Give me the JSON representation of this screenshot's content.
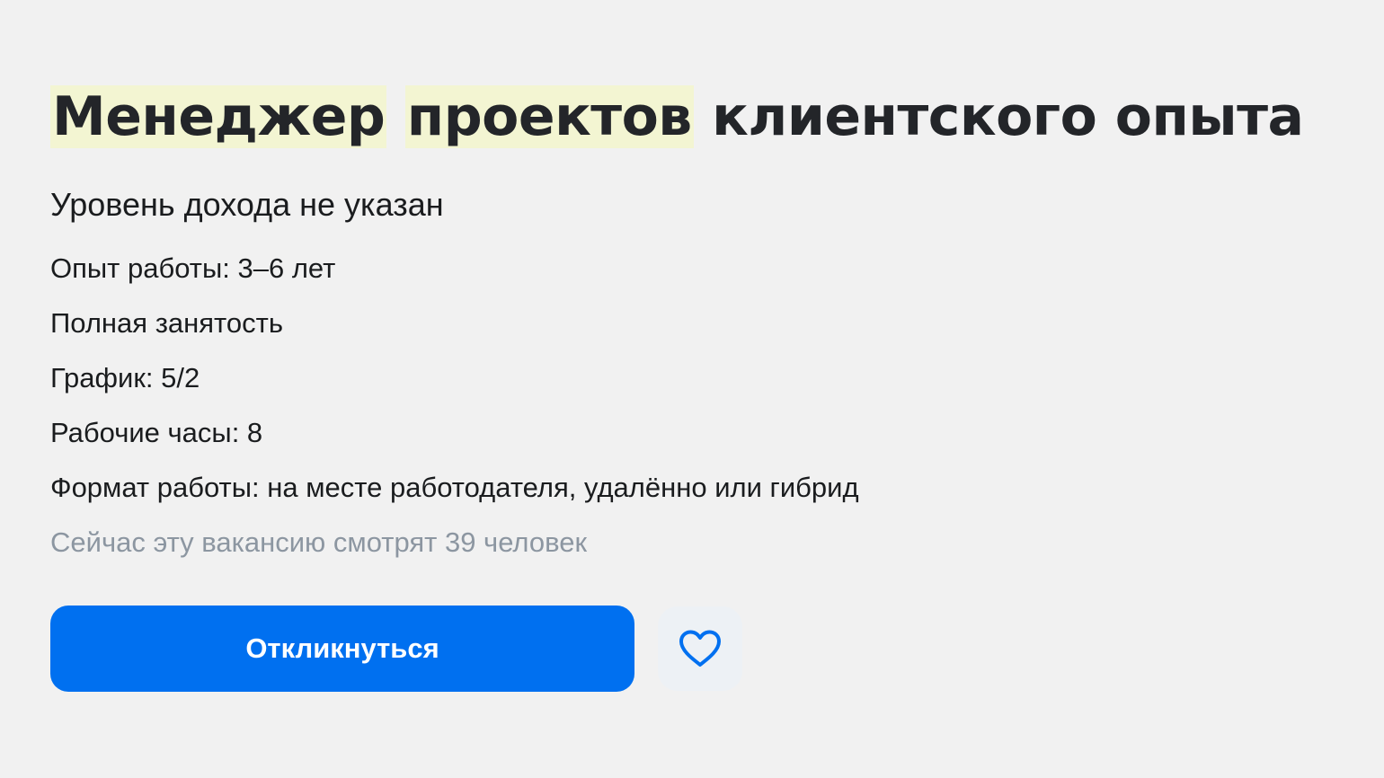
{
  "vacancy": {
    "title_highlight_1": "Менеджер",
    "title_highlight_2": "проектов",
    "title_rest": "клиентского опыта",
    "salary": "Уровень дохода не указан",
    "experience": "Опыт работы: 3–6 лет",
    "employment": "Полная занятость",
    "schedule": "График: 5/2",
    "hours": "Рабочие часы: 8",
    "work_format": "Формат работы: на месте работодателя, удалённо или гибрид",
    "viewers": "Сейчас эту вакансию смотрят 39 человек"
  },
  "actions": {
    "respond_label": "Откликнуться",
    "favorite_icon": "heart-icon"
  },
  "colors": {
    "background": "#f1f1f1",
    "highlight": "#f3f5d2",
    "primary": "#0070f0",
    "muted_text": "#8c96a1",
    "icon": "#0070f0"
  }
}
